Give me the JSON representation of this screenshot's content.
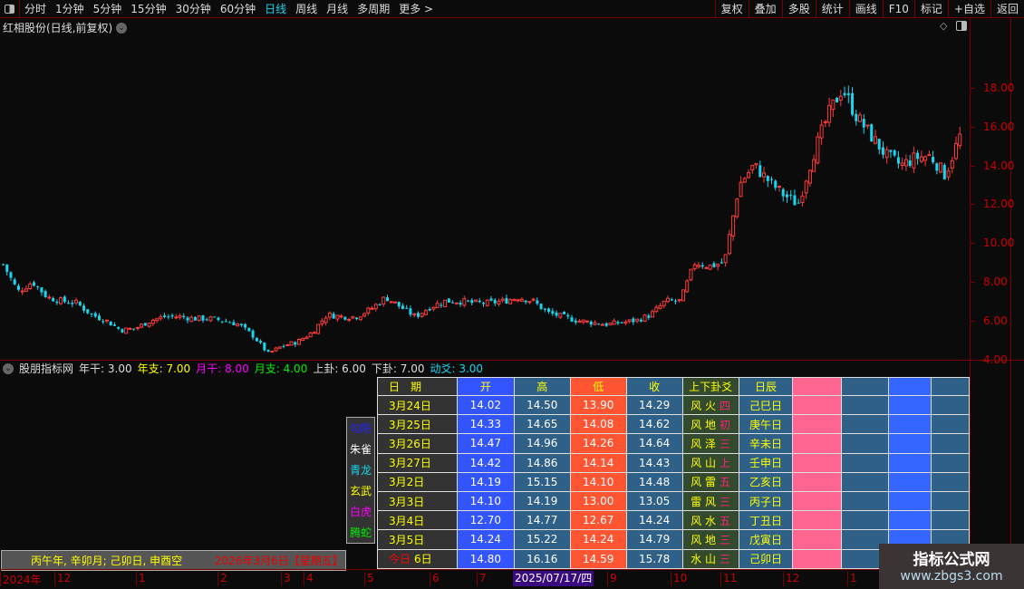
{
  "toolbar": {
    "periods": [
      "分时",
      "1分钟",
      "5分钟",
      "15分钟",
      "30分钟",
      "60分钟",
      "日线",
      "周线",
      "月线",
      "多周期",
      "更多 >"
    ],
    "active": "日线",
    "right_buttons": [
      "复权",
      "叠加",
      "多股",
      "统计",
      "画线",
      "F10",
      "标记",
      "+自选",
      "返回"
    ]
  },
  "chart": {
    "title": "红相股份(日线,前复权)",
    "price_ticks": [
      "18.00",
      "16.00",
      "14.00",
      "12.00",
      "10.00",
      "8.00",
      "6.00",
      "4.00"
    ],
    "up_color": "#ff3b3b",
    "down_color": "#16d6f0",
    "close_path": [
      8.9,
      7.5,
      8.0,
      7.2,
      7.0,
      6.9,
      6.3,
      6.0,
      5.5,
      5.6,
      6.0,
      6.2,
      6.2,
      6.1,
      6.1,
      6.0,
      5.8,
      5.2,
      4.3,
      4.7,
      4.9,
      5.4,
      6.3,
      6.2,
      6.2,
      6.6,
      7.2,
      6.7,
      6.2,
      6.7,
      7.0,
      7.0,
      6.9,
      6.9,
      7.0,
      7.2,
      7.0,
      6.4,
      6.2,
      6.0,
      5.9,
      5.8,
      5.9,
      6.0,
      6.3,
      7.0,
      7.0,
      9.0,
      8.8,
      9.0,
      13.0,
      14.0,
      13.2,
      12.5,
      12.0,
      14.5,
      16.5,
      18.0,
      16.5,
      15.5,
      14.5,
      14.0,
      14.4,
      14.5,
      13.5,
      15.5
    ]
  },
  "indicator": {
    "name": "股朋指标网",
    "items": [
      {
        "label": "年干: 3.00",
        "color": "#dddddd"
      },
      {
        "label": "年支: 7.00",
        "color": "#ffff00"
      },
      {
        "label": "月干: 8.00",
        "color": "#ff00ff"
      },
      {
        "label": "月支: 4.00",
        "color": "#00ee00"
      },
      {
        "label": "上卦: 6.00",
        "color": "#dddddd"
      },
      {
        "label": "下卦: 7.00",
        "color": "#dddddd"
      },
      {
        "label": "动爻: 3.00",
        "color": "#16d6f0"
      }
    ]
  },
  "table": {
    "headers": [
      "日　期",
      "开",
      "高",
      "低",
      "收",
      "上下卦爻",
      "日辰"
    ],
    "rows": [
      [
        "3月24日",
        "14.02",
        "14.50",
        "13.90",
        "14.29",
        "风 火",
        "四",
        "己巳日"
      ],
      [
        "3月25日",
        "14.33",
        "14.65",
        "14.08",
        "14.62",
        "风 地",
        "初",
        "庚午日"
      ],
      [
        "3月26日",
        "14.47",
        "14.96",
        "14.26",
        "14.64",
        "风 泽",
        "三",
        "辛未日"
      ],
      [
        "3月27日",
        "14.42",
        "14.86",
        "14.14",
        "14.43",
        "风 山",
        "上",
        "壬申日"
      ],
      [
        "3月2日",
        "14.19",
        "15.15",
        "14.10",
        "14.48",
        "风 雷",
        "五",
        "乙亥日"
      ],
      [
        "3月3日",
        "14.10",
        "14.19",
        "13.00",
        "13.05",
        "雷 风",
        "三",
        "丙子日"
      ],
      [
        "3月4日",
        "12.70",
        "14.77",
        "12.67",
        "14.24",
        "风 水",
        "五",
        "丁丑日"
      ],
      [
        "3月5日",
        "14.24",
        "15.22",
        "14.24",
        "14.79",
        "风 地",
        "三",
        "戊寅日"
      ],
      [
        "6日",
        "14.80",
        "16.16",
        "14.59",
        "15.78",
        "水 山",
        "三",
        "己卯日"
      ]
    ],
    "today_label": "今日"
  },
  "legend": [
    {
      "label": "勾陈",
      "color": "#2222ff"
    },
    {
      "label": "朱雀",
      "color": "#ffffff"
    },
    {
      "label": "青龙",
      "color": "#16d6f0"
    },
    {
      "label": "玄武",
      "color": "#ffff00"
    },
    {
      "label": "白虎",
      "color": "#ff00ff"
    },
    {
      "label": "腾蛇",
      "color": "#00ee00"
    }
  ],
  "info": {
    "ganzhi": "丙午年, 辛卯月; 己卯日, 申酉空",
    "date": "2026年3月6日【星期五】"
  },
  "time_axis": {
    "labels": [
      "2024年",
      "12",
      "1",
      "2",
      "3",
      "4",
      "5",
      "6",
      "7",
      "9",
      "10",
      "11",
      "12",
      "1"
    ],
    "cursor": "2025/07/17/四"
  },
  "watermark": {
    "name": "指标公式网",
    "url": "www.zbgs3.com"
  }
}
